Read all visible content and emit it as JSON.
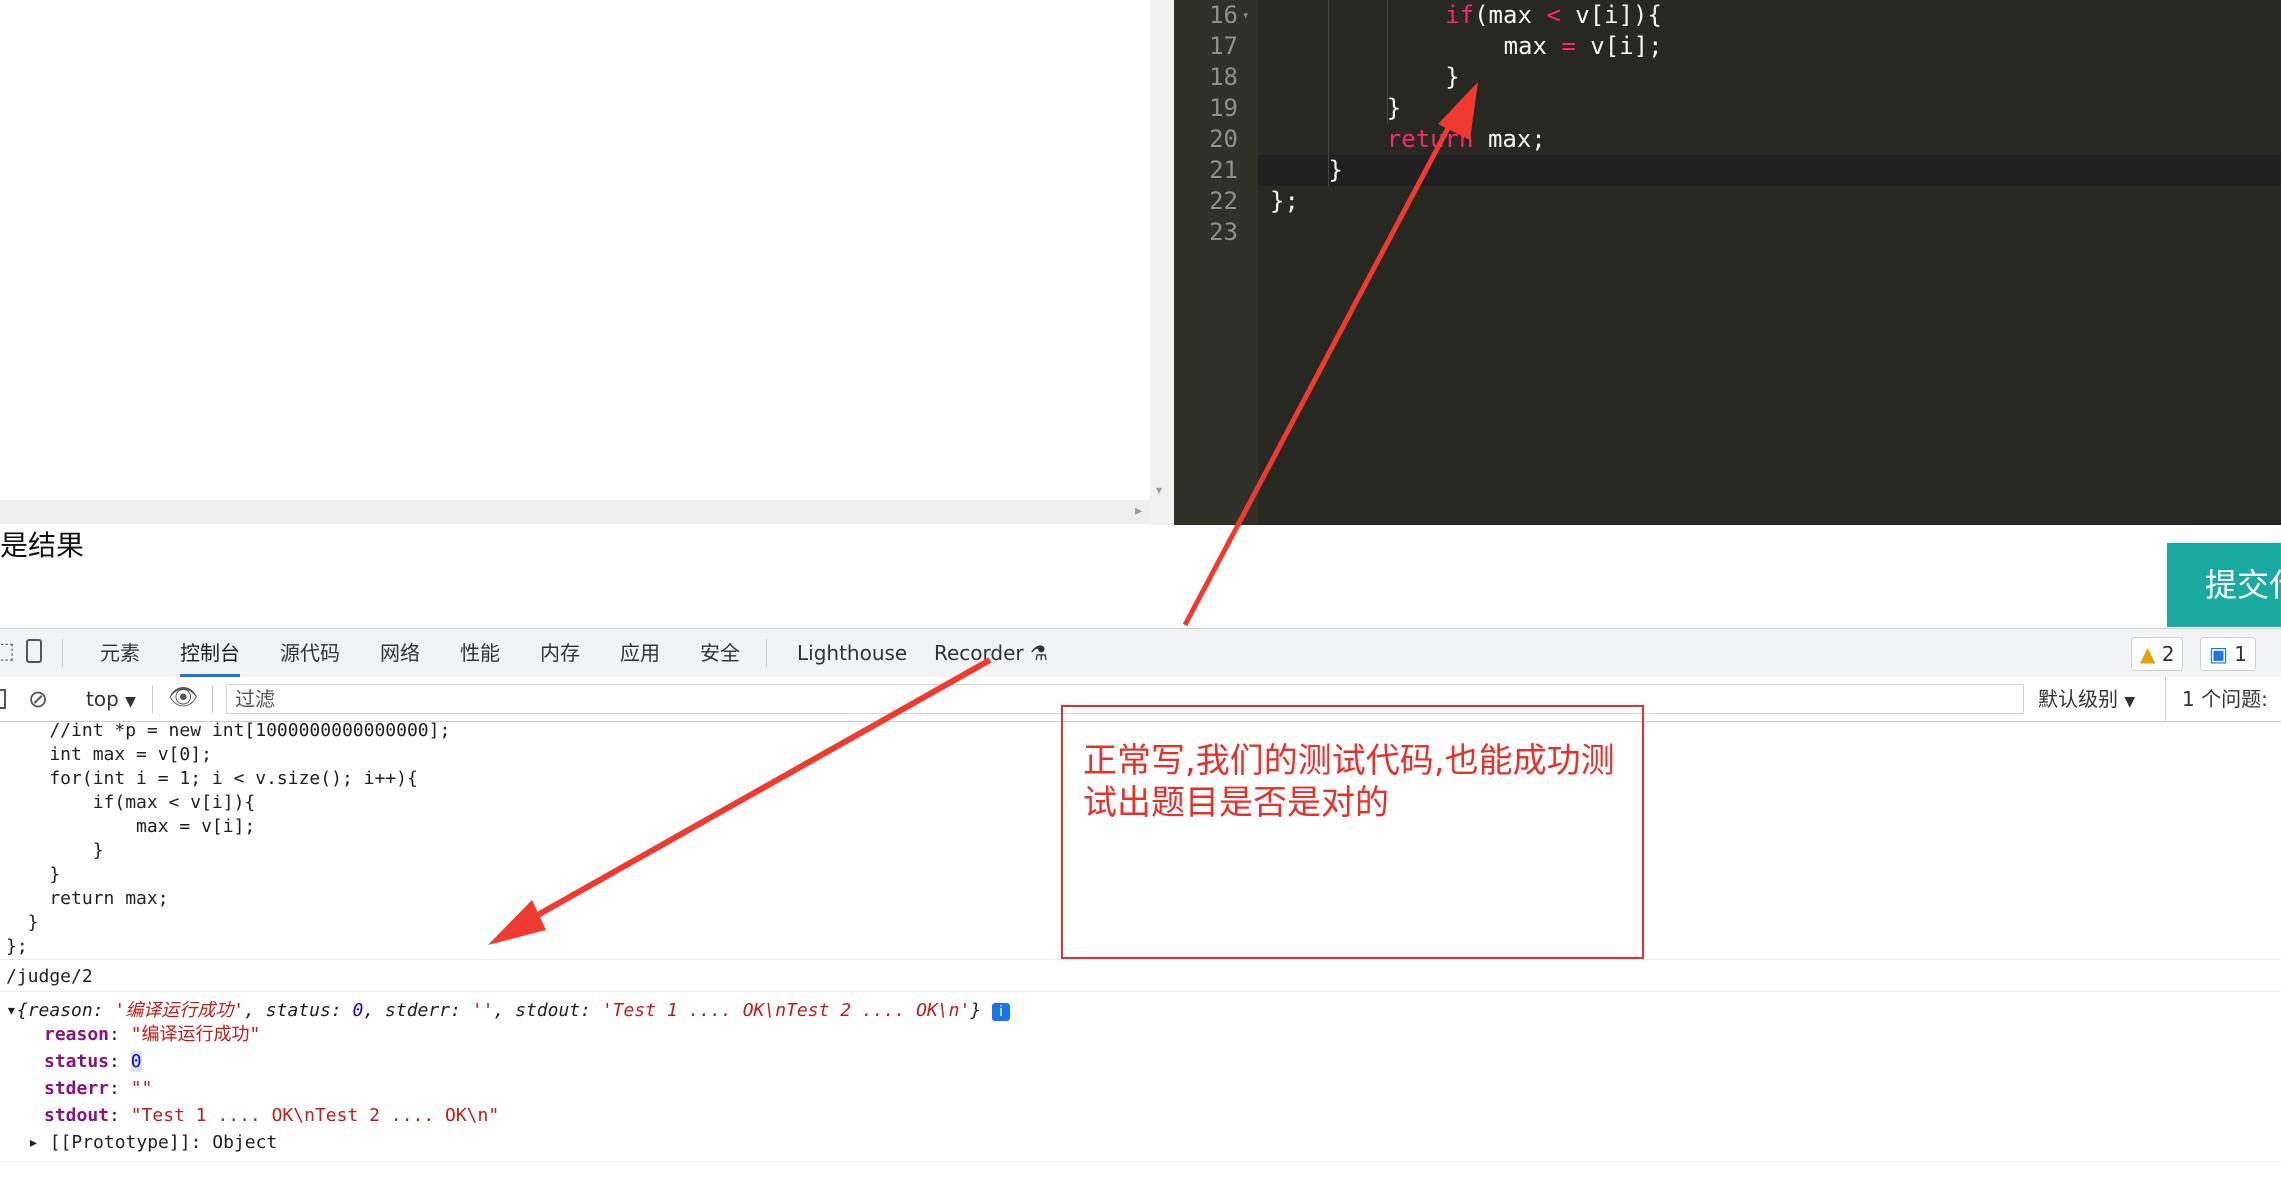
{
  "editor": {
    "lines": [
      {
        "num": "16",
        "fold": "▾",
        "indent": 12,
        "tokens": [
          {
            "t": "if",
            "c": "kw"
          },
          {
            "t": "(max "
          },
          {
            "t": "<",
            "c": "op"
          },
          {
            "t": " v[i]){"
          }
        ]
      },
      {
        "num": "17",
        "indent": 16,
        "tokens": [
          {
            "t": "max "
          },
          {
            "t": "=",
            "c": "op"
          },
          {
            "t": " v[i];"
          }
        ]
      },
      {
        "num": "18",
        "indent": 12,
        "tokens": [
          {
            "t": "}"
          }
        ]
      },
      {
        "num": "19",
        "indent": 8,
        "tokens": [
          {
            "t": "}"
          }
        ]
      },
      {
        "num": "20",
        "indent": 8,
        "tokens": [
          {
            "t": "return",
            "c": "kw"
          },
          {
            "t": " max;"
          }
        ]
      },
      {
        "num": "21",
        "indent": 4,
        "tokens": [
          {
            "t": "}"
          }
        ]
      },
      {
        "num": "22",
        "indent": 0,
        "tokens": [
          {
            "t": "};"
          }
        ]
      },
      {
        "num": "23",
        "indent": 0,
        "tokens": []
      }
    ]
  },
  "page": {
    "result_title": "是结果",
    "submit_label": "提交代"
  },
  "devtools": {
    "tabs": [
      "元素",
      "控制台",
      "源代码",
      "网络",
      "性能",
      "内存",
      "应用",
      "安全",
      "Lighthouse",
      "Recorder"
    ],
    "active_tab": "控制台",
    "warnings_count": "2",
    "messages_count": "1",
    "context": "top",
    "filter_placeholder": "过滤",
    "level": "默认级别",
    "issues": "1 个问题:"
  },
  "console": {
    "code_lines": [
      "    //int *p = new int[1000000000000000];",
      "    int max = v[0];",
      "    for(int i = 1; i < v.size(); i++){",
      "        if(max < v[i]){",
      "            max = v[i];",
      "        }",
      "    }",
      "    return max;",
      "  }",
      "};"
    ],
    "url_log": "/judge/2",
    "object_summary": {
      "reason_key": "reason",
      "reason_val": "'编译运行成功'",
      "status_key": "status",
      "status_val": "0",
      "stderr_key": "stderr",
      "stderr_val": "''",
      "stdout_key": "stdout",
      "stdout_val": "'Test 1 .... OK\\nTest 2 .... OK\\n'"
    },
    "props": [
      {
        "key": "reason",
        "val": "\"编译运行成功\"",
        "type": "s"
      },
      {
        "key": "status",
        "val": "0",
        "type": "n"
      },
      {
        "key": "stderr",
        "val": "\"\"",
        "type": "s"
      },
      {
        "key": "stdout",
        "val": "\"Test 1 .... OK\\nTest 2 .... OK\\n\"",
        "type": "s"
      }
    ],
    "prototype": "[[Prototype]]: Object"
  },
  "annotation": {
    "text": "正常写,我们的测试代码,也能成功测试出题目是否是对的",
    "color": "#e8302b"
  }
}
